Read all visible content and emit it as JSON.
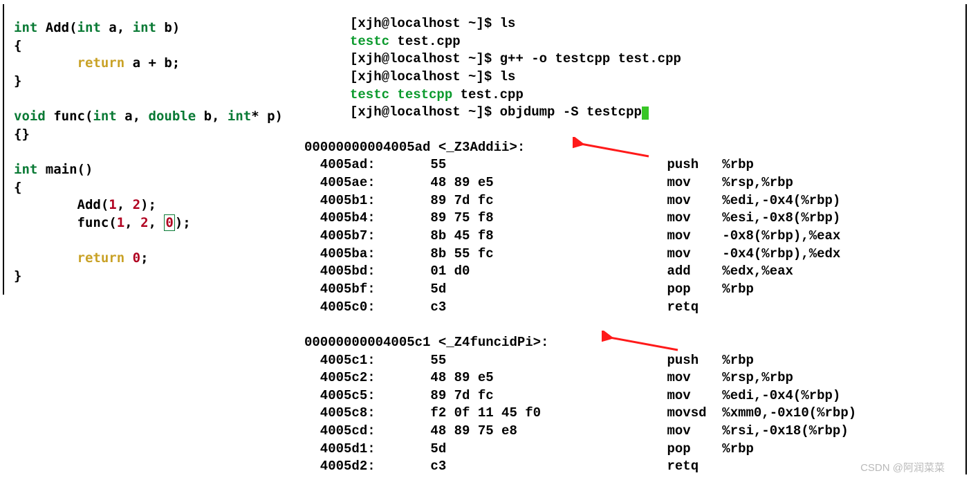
{
  "source_code": {
    "line1": {
      "t1": "int",
      "t2": " Add(",
      "t3": "int",
      "t4": " a, ",
      "t5": "int",
      "t6": " b)"
    },
    "line2": "{",
    "line3": {
      "indent": "        ",
      "ret": "return",
      "rest": " a + b;"
    },
    "line4": "}",
    "blank1": "",
    "line5": {
      "t1": "void",
      "t2": " func(",
      "t3": "int",
      "t4": " a, ",
      "t5": "double",
      "t6": " b, ",
      "t7": "int",
      "t8": "* p)"
    },
    "line6": "{}",
    "blank2": "",
    "line7": {
      "t1": "int",
      "t2": " main()"
    },
    "line8": "{",
    "line9": {
      "indent": "        ",
      "fn": "Add(",
      "n1": "1",
      "c1": ", ",
      "n2": "2",
      "end": ");"
    },
    "line10": {
      "indent": "        ",
      "fn": "func(",
      "n1": "1",
      "c1": ", ",
      "n2": "2",
      "c2": ", ",
      "n3": "0",
      "end": ");"
    },
    "blank3": "",
    "line11": {
      "indent": "        ",
      "ret": "return",
      "sp": " ",
      "n1": "0",
      "end": ";"
    },
    "line12": "}"
  },
  "terminal": {
    "prompt1": "[xjh@localhost ~]$ ls",
    "out1a": "testc",
    "out1b": "  test.cpp",
    "prompt2": "[xjh@localhost ~]$ g++ -o testcpp test.cpp",
    "prompt3": "[xjh@localhost ~]$ ls",
    "out2a": "testc  testcpp",
    "out2b": "  test.cpp",
    "prompt4": "[xjh@localhost ~]$ objdump -S testcpp"
  },
  "disasm": {
    "sec1_header": "00000000004005ad <_Z3Addii>:",
    "sec1": [
      {
        "addr": "4005ad:",
        "bytes": "55",
        "inst": "push",
        "args": "%rbp"
      },
      {
        "addr": "4005ae:",
        "bytes": "48 89 e5",
        "inst": "mov",
        "args": "%rsp,%rbp"
      },
      {
        "addr": "4005b1:",
        "bytes": "89 7d fc",
        "inst": "mov",
        "args": "%edi,-0x4(%rbp)"
      },
      {
        "addr": "4005b4:",
        "bytes": "89 75 f8",
        "inst": "mov",
        "args": "%esi,-0x8(%rbp)"
      },
      {
        "addr": "4005b7:",
        "bytes": "8b 45 f8",
        "inst": "mov",
        "args": "-0x8(%rbp),%eax"
      },
      {
        "addr": "4005ba:",
        "bytes": "8b 55 fc",
        "inst": "mov",
        "args": "-0x4(%rbp),%edx"
      },
      {
        "addr": "4005bd:",
        "bytes": "01 d0",
        "inst": "add",
        "args": "%edx,%eax"
      },
      {
        "addr": "4005bf:",
        "bytes": "5d",
        "inst": "pop",
        "args": "%rbp"
      },
      {
        "addr": "4005c0:",
        "bytes": "c3",
        "inst": "retq",
        "args": ""
      }
    ],
    "sec2_header": "00000000004005c1 <_Z4funcidPi>:",
    "sec2": [
      {
        "addr": "4005c1:",
        "bytes": "55",
        "inst": "push",
        "args": "%rbp"
      },
      {
        "addr": "4005c2:",
        "bytes": "48 89 e5",
        "inst": "mov",
        "args": "%rsp,%rbp"
      },
      {
        "addr": "4005c5:",
        "bytes": "89 7d fc",
        "inst": "mov",
        "args": "%edi,-0x4(%rbp)"
      },
      {
        "addr": "4005c8:",
        "bytes": "f2 0f 11 45 f0",
        "inst": "movsd",
        "args": "%xmm0,-0x10(%rbp)"
      },
      {
        "addr": "4005cd:",
        "bytes": "48 89 75 e8",
        "inst": "mov",
        "args": "%rsi,-0x18(%rbp)"
      },
      {
        "addr": "4005d1:",
        "bytes": "5d",
        "inst": "pop",
        "args": "%rbp"
      },
      {
        "addr": "4005d2:",
        "bytes": "c3",
        "inst": "retq",
        "args": ""
      }
    ]
  },
  "watermark": "CSDN @阿润菜菜"
}
